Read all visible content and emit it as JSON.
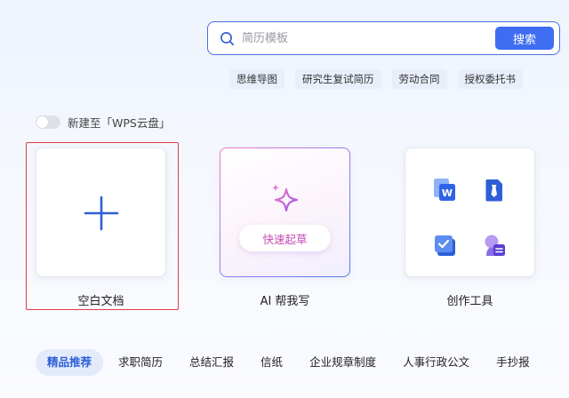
{
  "search": {
    "placeholder": "简历模板",
    "button_label": "搜索"
  },
  "hot_tags": [
    "思维导图",
    "研究生复试简历",
    "劳动合同",
    "授权委托书"
  ],
  "cloud_toggle": {
    "label": "新建至「WPS云盘」",
    "enabled": false
  },
  "cards": {
    "blank": {
      "caption": "空白文档",
      "icon": "plus-icon"
    },
    "ai": {
      "caption": "AI 帮我写",
      "button_label": "快速起草",
      "icon": "sparkle-icon"
    },
    "tools": {
      "caption": "创作工具",
      "icons": [
        "word-doc-icon",
        "tie-doc-icon",
        "checklist-icon",
        "avatar-doc-icon"
      ]
    }
  },
  "categories": [
    {
      "label": "精品推荐",
      "active": true
    },
    {
      "label": "求职简历",
      "active": false
    },
    {
      "label": "总结汇报",
      "active": false
    },
    {
      "label": "信纸",
      "active": false
    },
    {
      "label": "企业规章制度",
      "active": false
    },
    {
      "label": "人事行政公文",
      "active": false
    },
    {
      "label": "手抄报",
      "active": false
    }
  ],
  "colors": {
    "accent": "#3f6df2",
    "selection": "#e23b4a",
    "ai_pink": "#c24bb3"
  }
}
